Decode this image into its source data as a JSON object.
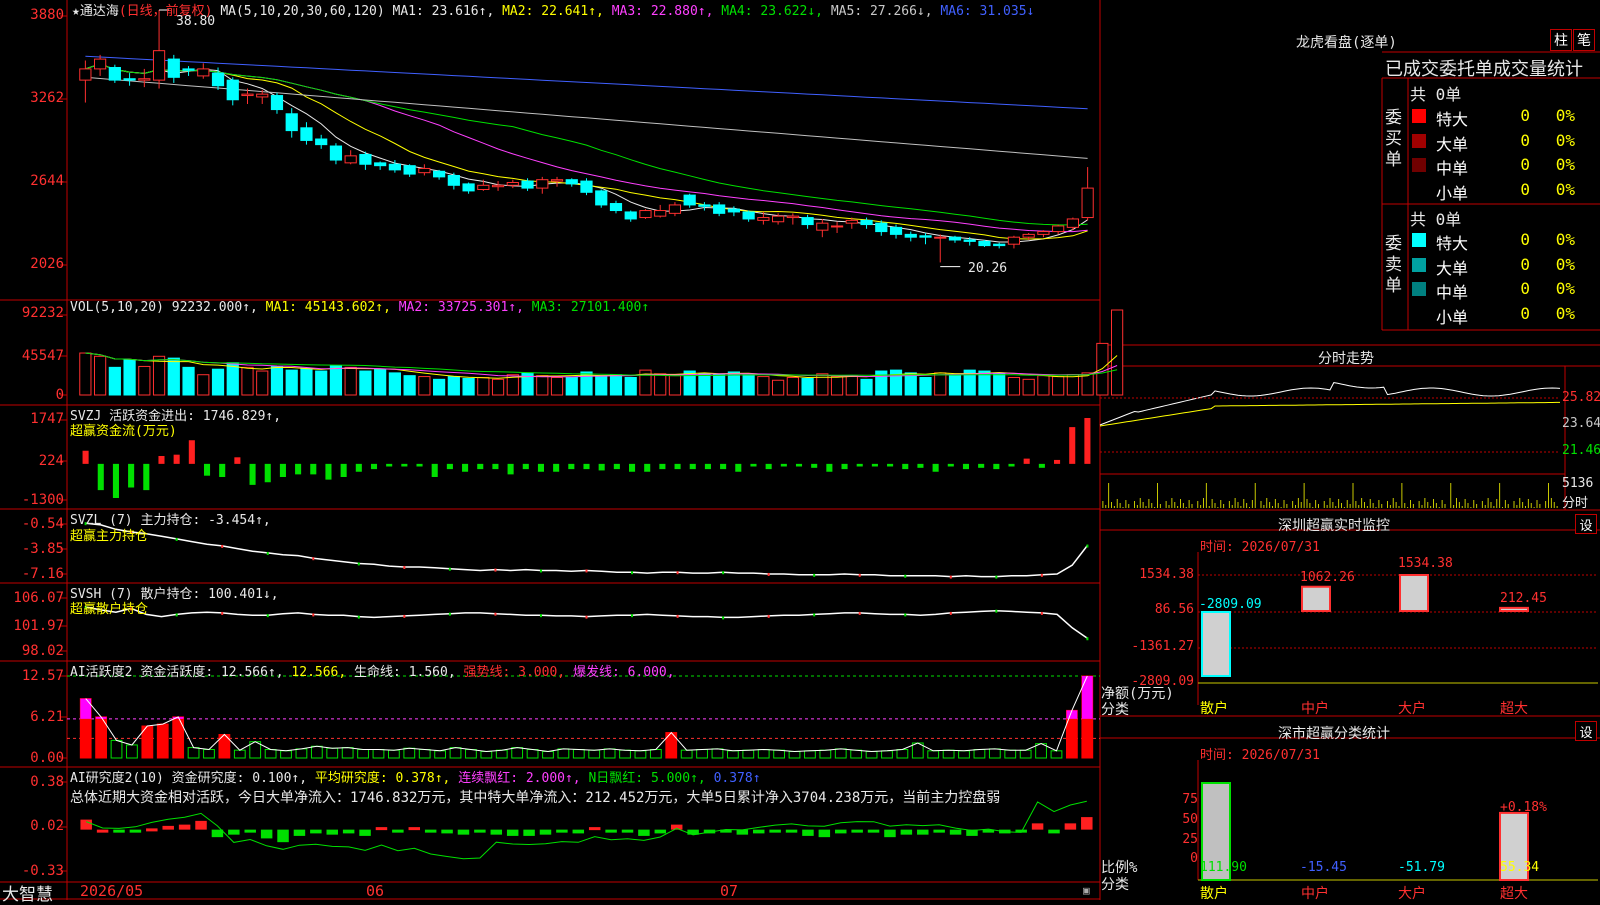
{
  "app": {
    "brand": "大智慧"
  },
  "main_chart": {
    "title_star": "★",
    "stock_name": "通达海",
    "period": "(日线，前复权)",
    "ma_label": "MA(5,10,20,30,60,120)",
    "ma1": "MA1: 23.616↑,",
    "ma2": "MA2: 22.641↑,",
    "ma3": "MA3: 22.880↑,",
    "ma4": "MA4: 23.622↓,",
    "ma5": "MA5: 27.266↓,",
    "ma6": "MA6: 31.035↓",
    "high_label": "38.80",
    "low_label": "20.26",
    "y_ticks": [
      "3880",
      "3262",
      "2644",
      "2026"
    ]
  },
  "vol_panel": {
    "title": "VOL(5,10,20)",
    "value": "92232.000↑,",
    "ma1": "MA1: 45143.602↑,",
    "ma2": "MA2: 33725.301↑,",
    "ma3": "MA3: 27101.400↑",
    "y_ticks": [
      "92232",
      "45547",
      "0"
    ]
  },
  "svzj_panel": {
    "title": "SVZJ",
    "label": "活跃资金进出: 1746.829↑,",
    "sub": "超赢资金流(万元)",
    "y_ticks": [
      "1747",
      "224",
      "-1300"
    ]
  },
  "svzl_panel": {
    "title": "SVZL (7)",
    "label": "主力持仓: -3.454↑,",
    "sub": "超赢主力持仓",
    "y_ticks": [
      "-0.54",
      "-3.85",
      "-7.16"
    ]
  },
  "svsh_panel": {
    "title": "SVSH (7)",
    "label": "散户持仓: 100.401↓,",
    "sub": "超赢散户持仓",
    "y_ticks": [
      "106.07",
      "101.97",
      "98.02"
    ]
  },
  "ai_active_panel": {
    "title": "AI活跃度2",
    "label": "资金活跃度: 12.566↑,",
    "val2": "12.566,",
    "life": "生命线: 1.560,",
    "strong": "强势线: 3.000,",
    "burst": "爆发线: 6.000,",
    "y_ticks": [
      "12.57",
      "6.21",
      "0.00"
    ]
  },
  "ai_research_panel": {
    "title": "AI研究度2(10)",
    "label": "资金研究度: 0.100↑,",
    "avg": "平均研究度: 0.378↑,",
    "consec": "连续飘红: 2.000↑,",
    "nday": "N日飘红: 5.000↑,",
    "extra": "0.378↑",
    "summary": "总体近期大资金相对活跃，今日大单净流入：1746.832万元，其中特大单净流入：212.452万元，大单5日累计净入3704.238万元，当前主力控盘弱",
    "y_ticks": [
      "0.38",
      "0.02",
      "-0.33"
    ]
  },
  "x_axis": {
    "labels": [
      "2026/05",
      "06",
      "07"
    ]
  },
  "dragon_tiger": {
    "title": "龙虎看盘(逐单)",
    "btn_bar": "柱",
    "btn_list": "笔",
    "header": "已成交委托单成交量统计",
    "buy_side": "委买单",
    "sell_side": "委卖单",
    "buy_total": "共 0单",
    "sell_total": "共 0单",
    "rows_buy": [
      {
        "label": "特大",
        "count": "0",
        "pct": "0%",
        "color": "#ff0000"
      },
      {
        "label": "大单",
        "count": "0",
        "pct": "0%",
        "color": "#a00000"
      },
      {
        "label": "中单",
        "count": "0",
        "pct": "0%",
        "color": "#700000"
      },
      {
        "label": "小单",
        "count": "0",
        "pct": "0%",
        "color": "#000000"
      }
    ],
    "rows_sell": [
      {
        "label": "特大",
        "count": "0",
        "pct": "0%",
        "color": "#00ffff"
      },
      {
        "label": "大单",
        "count": "0",
        "pct": "0%",
        "color": "#00a0a0"
      },
      {
        "label": "中单",
        "count": "0",
        "pct": "0%",
        "color": "#008080"
      },
      {
        "label": "小单",
        "count": "0",
        "pct": "0%",
        "color": "#000000"
      }
    ]
  },
  "intraday": {
    "title": "分时走势",
    "y_ticks": [
      "25.82",
      "23.64",
      "21.46"
    ],
    "vol_tick": "5136",
    "vol_label": "分时"
  },
  "sz_monitor": {
    "title": "深圳超赢实时监控",
    "btn": "设",
    "time": "时间: 2026/07/31",
    "y_ticks": [
      "1534.38",
      "86.56",
      "-1361.27",
      "-2809.09"
    ],
    "axis_label": "净额(万元)",
    "cat_label": "分类",
    "cats": [
      "散户",
      "中户",
      "大户",
      "超大"
    ],
    "values_text": [
      "-2809.09",
      "1062.26",
      "1534.38",
      "212.45"
    ]
  },
  "sz_class": {
    "title": "深市超赢分类统计",
    "btn": "设",
    "time": "时间: 2026/07/31",
    "y_ticks": [
      "75",
      "50",
      "25",
      "0"
    ],
    "axis_label": "比例%",
    "cat_label": "分类",
    "cats": [
      "散户",
      "中户",
      "大户",
      "超大"
    ],
    "values_text": [
      "111.90",
      "-15.45",
      "-51.79",
      "55.34"
    ],
    "top_label": "+0.18%"
  },
  "chart_data": [
    {
      "type": "candlestick",
      "ylim": [
        2026,
        3880
      ],
      "candles": [
        [
          33.8,
          34.6,
          32.2,
          35.2
        ],
        [
          34.6,
          35.3,
          34.1,
          35.6
        ],
        [
          34.7,
          33.8,
          33.6,
          34.9
        ],
        [
          33.9,
          33.8,
          33.4,
          34.3
        ],
        [
          33.8,
          33.9,
          33.3,
          34.6
        ],
        [
          33.8,
          35.9,
          33.2,
          38.8
        ],
        [
          35.3,
          34.0,
          33.6,
          35.6
        ],
        [
          34.6,
          34.5,
          34.1,
          34.8
        ],
        [
          34.1,
          34.6,
          33.9,
          35.0
        ],
        [
          34.3,
          33.4,
          33.1,
          34.7
        ],
        [
          33.8,
          32.4,
          32.0,
          34.0
        ],
        [
          32.7,
          32.8,
          32.1,
          33.2
        ],
        [
          32.6,
          32.8,
          32.1,
          33.1
        ],
        [
          32.7,
          31.7,
          31.4,
          32.9
        ],
        [
          31.4,
          30.2,
          29.7,
          31.8
        ],
        [
          30.4,
          29.5,
          29.2,
          30.8
        ],
        [
          29.6,
          29.2,
          28.9,
          29.9
        ],
        [
          29.1,
          28.1,
          27.8,
          29.3
        ],
        [
          27.9,
          28.4,
          27.8,
          28.8
        ],
        [
          28.5,
          27.8,
          27.4,
          28.7
        ],
        [
          27.9,
          27.7,
          27.4,
          28.0
        ],
        [
          27.8,
          27.4,
          27.2,
          28.1
        ],
        [
          27.7,
          27.1,
          26.9,
          27.8
        ],
        [
          27.2,
          27.5,
          27.0,
          27.8
        ],
        [
          27.3,
          26.9,
          26.7,
          27.4
        ],
        [
          27.0,
          26.3,
          26.0,
          27.2
        ],
        [
          26.4,
          25.9,
          25.7,
          26.5
        ],
        [
          26.0,
          26.3,
          25.9,
          26.7
        ],
        [
          26.2,
          26.3,
          25.9,
          26.6
        ],
        [
          26.3,
          26.5,
          26.1,
          26.7
        ],
        [
          26.6,
          26.1,
          25.9,
          26.8
        ],
        [
          26.1,
          26.7,
          25.7,
          26.9
        ],
        [
          26.6,
          26.7,
          26.2,
          26.9
        ],
        [
          26.7,
          26.4,
          26.2,
          26.8
        ],
        [
          26.6,
          25.8,
          25.6,
          26.8
        ],
        [
          25.9,
          24.9,
          24.7,
          26.0
        ],
        [
          25.0,
          24.5,
          24.3,
          25.2
        ],
        [
          24.4,
          23.9,
          23.7,
          24.5
        ],
        [
          24.0,
          24.5,
          23.9,
          24.6
        ],
        [
          24.1,
          24.5,
          24.0,
          24.9
        ],
        [
          24.3,
          24.9,
          24.1,
          25.1
        ],
        [
          25.6,
          24.9,
          24.7,
          25.7
        ],
        [
          24.9,
          24.8,
          24.5,
          25.1
        ],
        [
          24.9,
          24.3,
          24.1,
          25.1
        ],
        [
          24.6,
          24.4,
          24.1,
          24.8
        ],
        [
          24.4,
          23.9,
          23.7,
          24.5
        ],
        [
          23.8,
          24.0,
          23.5,
          24.4
        ],
        [
          23.7,
          24.1,
          23.5,
          24.3
        ],
        [
          24.0,
          24.1,
          23.5,
          24.3
        ],
        [
          24.0,
          23.5,
          23.2,
          24.2
        ],
        [
          23.1,
          23.6,
          22.6,
          23.9
        ],
        [
          23.4,
          23.4,
          22.9,
          23.7
        ],
        [
          23.6,
          23.8,
          23.2,
          24.0
        ],
        [
          23.8,
          23.5,
          23.2,
          24.0
        ],
        [
          23.6,
          23.0,
          22.7,
          23.8
        ],
        [
          23.3,
          22.8,
          22.5,
          23.5
        ],
        [
          22.8,
          22.6,
          22.3,
          23.0
        ],
        [
          22.7,
          22.6,
          22.1,
          22.9
        ],
        [
          22.6,
          22.6,
          20.8,
          22.8
        ],
        [
          22.6,
          22.4,
          22.2,
          22.7
        ],
        [
          22.4,
          22.3,
          22.0,
          22.6
        ],
        [
          22.3,
          22.0,
          21.9,
          22.4
        ],
        [
          22.1,
          22.0,
          21.8,
          22.2
        ],
        [
          22.1,
          22.6,
          21.8,
          22.7
        ],
        [
          22.6,
          22.8,
          22.4,
          22.9
        ],
        [
          22.8,
          23.0,
          22.6,
          23.1
        ],
        [
          23.0,
          23.4,
          22.8,
          23.5
        ],
        [
          23.3,
          23.9,
          23.1,
          24.0
        ],
        [
          24.0,
          26.1,
          23.8,
          27.6
        ]
      ]
    },
    {
      "type": "bar",
      "name": "VOL",
      "ylim": [
        0,
        92232
      ],
      "values": [
        45547,
        42000,
        30000,
        38000,
        31000,
        42000,
        40000,
        30000,
        22000,
        28000,
        35000,
        30000,
        26000,
        31000,
        27000,
        29000,
        26000,
        32000,
        30000,
        26000,
        28000,
        24000,
        21000,
        20000,
        17000,
        20000,
        18000,
        19000,
        17000,
        22000,
        24000,
        21000,
        19000,
        19000,
        25000,
        21000,
        22000,
        19000,
        27000,
        23000,
        21000,
        26000,
        23000,
        22000,
        25000,
        22000,
        20000,
        16000,
        19000,
        18000,
        23000,
        20000,
        21000,
        17000,
        26000,
        27000,
        24000,
        19000,
        24000,
        22000,
        27000,
        26000,
        23000,
        19000,
        17000,
        21000,
        20000,
        22000,
        24000,
        56000,
        92232
      ]
    },
    {
      "type": "bar",
      "name": "活跃资金进出",
      "ylim": [
        -1300,
        1747
      ],
      "values": [
        500,
        -1000,
        -1300,
        -900,
        -1000,
        300,
        350,
        900,
        -450,
        -500,
        250,
        -800,
        -700,
        -500,
        -400,
        -400,
        -600,
        -500,
        -300,
        -200,
        -100,
        -100,
        -100,
        -500,
        -200,
        -300,
        -200,
        -200,
        -400,
        -200,
        -300,
        -300,
        -200,
        -200,
        -250,
        -200,
        -300,
        -300,
        -200,
        -200,
        -200,
        -200,
        -200,
        -300,
        -100,
        -200,
        -100,
        -100,
        -150,
        -300,
        -200,
        -100,
        -100,
        -100,
        -200,
        -150,
        -300,
        -100,
        -200,
        -150,
        -200,
        -100,
        200,
        -150,
        150,
        1400,
        1746.829
      ]
    },
    {
      "type": "line",
      "name": "主力持仓",
      "ylim": [
        -7.16,
        -0.54
      ],
      "values": [
        -0.9,
        -1.1,
        -1.6,
        -1.9,
        -2.1,
        -2.4,
        -2.7,
        -3.0,
        -3.3,
        -3.5,
        -3.8,
        -4.1,
        -4.3,
        -4.5,
        -4.6,
        -4.9,
        -5.1,
        -5.3,
        -5.5,
        -5.6,
        -5.8,
        -5.9,
        -5.9,
        -6.0,
        -6.1,
        -6.2,
        -6.3,
        -6.2,
        -6.3,
        -6.2,
        -6.3,
        -6.3,
        -6.4,
        -6.3,
        -6.4,
        -6.5,
        -6.5,
        -6.6,
        -6.5,
        -6.5,
        -6.6,
        -6.6,
        -6.5,
        -6.6,
        -6.6,
        -6.7,
        -6.7,
        -6.8,
        -6.8,
        -6.8,
        -6.7,
        -6.8,
        -6.8,
        -6.9,
        -6.9,
        -6.9,
        -6.9,
        -7.0,
        -6.9,
        -7.0,
        -7.0,
        -6.9,
        -6.9,
        -6.8,
        -6.7,
        -5.7,
        -3.454
      ]
    },
    {
      "type": "line",
      "name": "散户持仓",
      "ylim": [
        98.02,
        106.07
      ],
      "values": [
        104.6,
        104.2,
        103.9,
        104.4,
        103.6,
        103.3,
        103.6,
        103.8,
        103.9,
        103.8,
        103.6,
        103.5,
        103.5,
        103.7,
        103.8,
        103.6,
        103.5,
        103.5,
        103.3,
        103.2,
        103.3,
        103.4,
        103.5,
        103.6,
        103.7,
        103.8,
        103.8,
        103.7,
        103.6,
        103.5,
        103.5,
        103.4,
        103.4,
        103.3,
        103.4,
        103.5,
        103.5,
        103.6,
        103.5,
        103.4,
        103.3,
        103.3,
        103.2,
        103.2,
        103.3,
        103.4,
        103.5,
        103.5,
        103.6,
        103.7,
        103.8,
        103.8,
        103.7,
        103.6,
        103.6,
        103.5,
        103.6,
        103.8,
        103.9,
        104.0,
        104.1,
        104.0,
        103.9,
        103.8,
        103.6,
        101.8,
        100.401
      ]
    },
    {
      "type": "bar",
      "name": "资金活跃度",
      "ylim": [
        0,
        12.57
      ],
      "values": [
        9.1,
        6.3,
        2.7,
        2.0,
        4.9,
        5.2,
        6.3,
        1.6,
        1.3,
        3.6,
        1.2,
        2.5,
        1.3,
        1.1,
        1.4,
        1.8,
        1.5,
        1.6,
        1.3,
        1.3,
        1.2,
        1.5,
        1.3,
        1.1,
        1.6,
        1.3,
        1.0,
        1.2,
        1.6,
        1.3,
        1.0,
        1.4,
        1.3,
        1.2,
        1.4,
        1.2,
        1.1,
        1.3,
        3.9,
        1.2,
        1.3,
        1.4,
        1.1,
        1.2,
        1.3,
        1.2,
        1.0,
        1.1,
        1.2,
        1.4,
        1.2,
        1.0,
        1.1,
        1.3,
        2.3,
        1.1,
        1.2,
        1.1,
        1.3,
        1.4,
        1.2,
        1.2,
        2.2,
        1.1,
        7.3,
        12.566
      ],
      "lines": {
        "生命线": 1.56,
        "强势线": 3.0,
        "爆发线": 6.0
      }
    },
    {
      "type": "bar",
      "name": "资金研究度",
      "ylim": [
        -0.33,
        0.38
      ],
      "values": [
        0.08,
        0.0,
        -0.02,
        -0.02,
        0.01,
        0.03,
        0.04,
        0.07,
        -0.06,
        -0.04,
        -0.01,
        -0.07,
        -0.1,
        -0.05,
        -0.03,
        -0.04,
        -0.03,
        -0.05,
        0.02,
        -0.02,
        0.02,
        -0.02,
        -0.03,
        -0.04,
        -0.02,
        -0.04,
        -0.05,
        -0.05,
        -0.04,
        -0.02,
        -0.03,
        0.02,
        -0.02,
        -0.02,
        -0.05,
        -0.03,
        0.04,
        -0.04,
        -0.03,
        -0.02,
        -0.04,
        -0.03,
        -0.02,
        -0.02,
        -0.05,
        -0.06,
        -0.03,
        -0.02,
        -0.02,
        -0.06,
        -0.04,
        -0.04,
        -0.02,
        -0.04,
        -0.05,
        -0.02,
        -0.03,
        -0.02,
        0.05,
        -0.03,
        0.05,
        0.1
      ]
    },
    {
      "type": "bar",
      "name": "深圳超赢实时监控",
      "categories": [
        "散户",
        "中户",
        "大户",
        "超大"
      ],
      "values": [
        -2809.09,
        1062.26,
        1534.38,
        212.45
      ],
      "ylim": [
        -2809.09,
        1534.38
      ]
    },
    {
      "type": "bar",
      "name": "深市超赢分类统计",
      "categories": [
        "散户",
        "中户",
        "大户",
        "超大"
      ],
      "values": [
        111.9,
        -15.45,
        -51.79,
        55.34
      ],
      "ylim": [
        0,
        75
      ]
    }
  ]
}
